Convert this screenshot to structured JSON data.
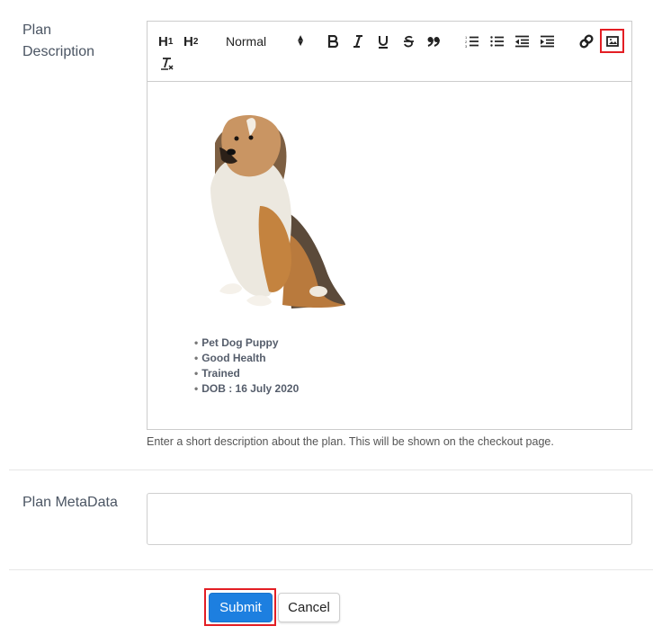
{
  "form": {
    "plan_description": {
      "label": "Plan Description",
      "help_text": "Enter a short description about the plan. This will be shown on the checkout page."
    },
    "plan_metadata": {
      "label": "Plan MetaData",
      "value": ""
    }
  },
  "editor": {
    "toolbar": {
      "h1": "H",
      "h1_sub": "1",
      "h2": "H",
      "h2_sub": "2",
      "format_select": "Normal",
      "icons": [
        "h1-icon",
        "h2-icon",
        "bold-icon",
        "italic-icon",
        "underline-icon",
        "strikethrough-icon",
        "blockquote-icon",
        "ordered-list-icon",
        "bullet-list-icon",
        "outdent-icon",
        "indent-icon",
        "link-icon",
        "image-icon",
        "clear-format-icon"
      ],
      "highlighted_button": "image-icon",
      "highlight_color": "#e31e24"
    },
    "content": {
      "image": "sitting-dog-image",
      "bullets": [
        "Pet Dog Puppy",
        "Good Health",
        "Trained",
        "DOB : 16 July 2020"
      ]
    }
  },
  "actions": {
    "submit_label": "Submit",
    "cancel_label": "Cancel",
    "submit_color": "#1d7fe0"
  }
}
